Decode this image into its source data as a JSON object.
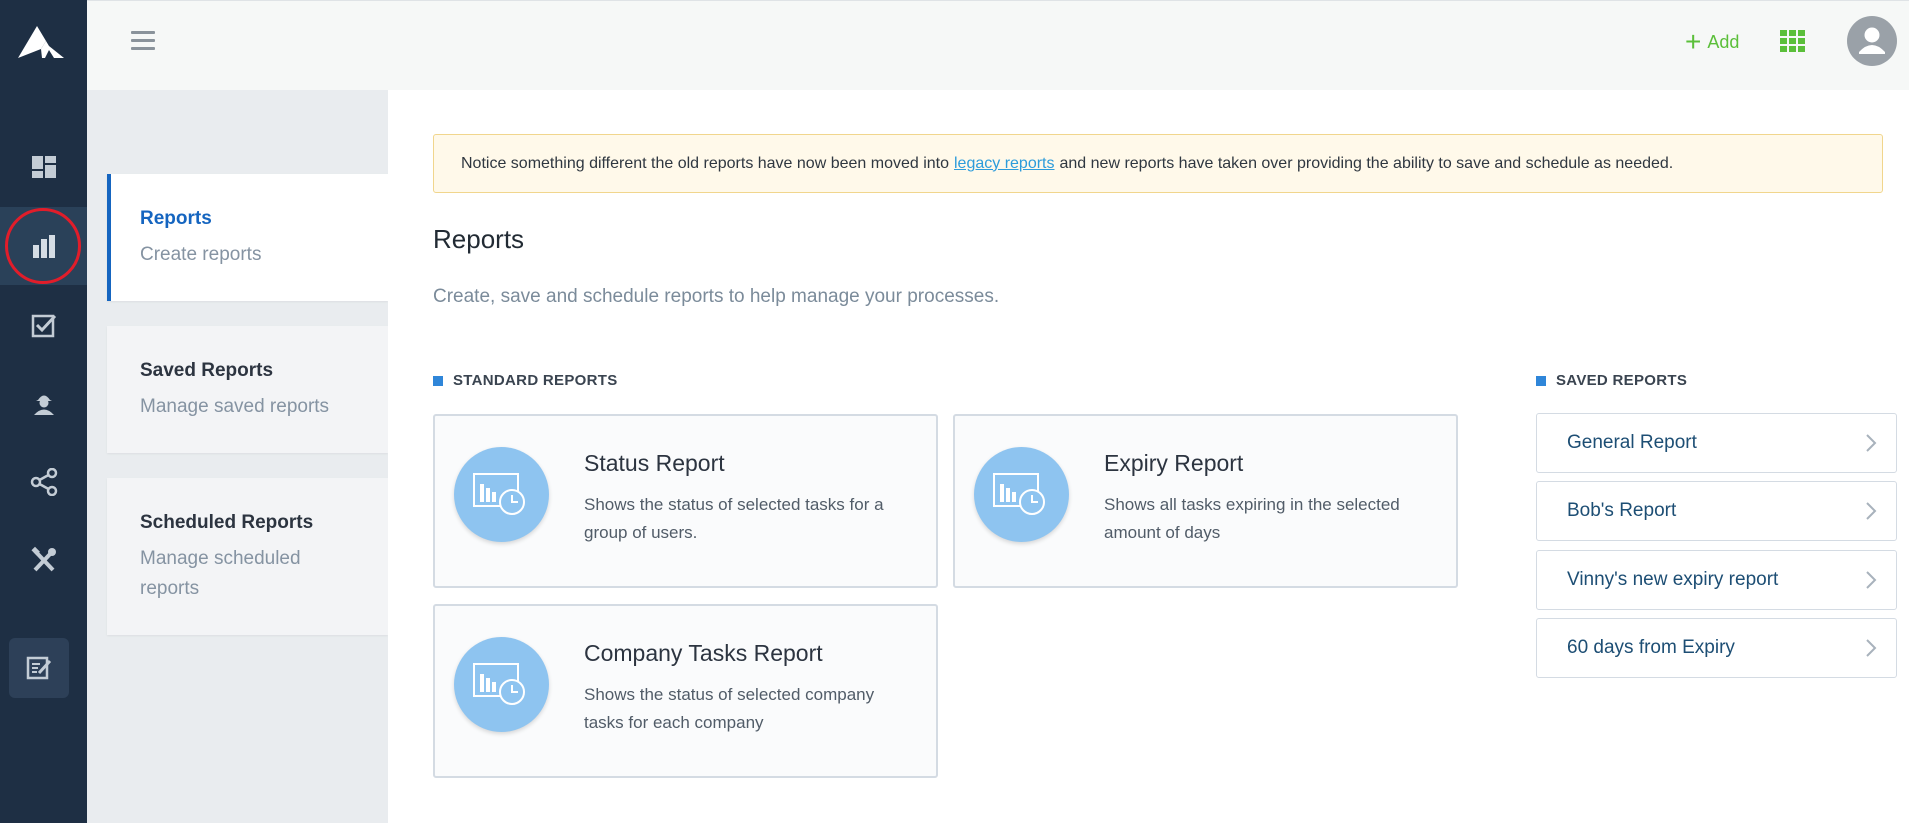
{
  "topbar": {
    "add_label": "Add"
  },
  "left_panel": {
    "items": [
      {
        "title": "Reports",
        "subtitle": "Create reports"
      },
      {
        "title": "Saved Reports",
        "subtitle": "Manage saved reports"
      },
      {
        "title": "Scheduled Reports",
        "subtitle": "Manage scheduled reports"
      }
    ]
  },
  "notice": {
    "before": "Notice something different the old reports have now been moved into",
    "link": "legacy reports",
    "after": "and new reports have taken over providing the ability to save and schedule as needed."
  },
  "main": {
    "title": "Reports",
    "subtitle": "Create, save and schedule reports to help manage your processes."
  },
  "standard_reports": {
    "heading": "STANDARD REPORTS",
    "items": [
      {
        "title": "Status Report",
        "description": "Shows the status of selected tasks for a group of users."
      },
      {
        "title": "Expiry Report",
        "description": "Shows all tasks expiring in the selected amount of days"
      },
      {
        "title": "Company Tasks Report",
        "description": "Shows the status of selected company tasks for each company"
      }
    ]
  },
  "saved_reports": {
    "heading": "SAVED REPORTS",
    "items": [
      {
        "label": "General Report"
      },
      {
        "label": "Bob's Report"
      },
      {
        "label": "Vinny's new expiry report"
      },
      {
        "label": "60 days from Expiry"
      }
    ]
  },
  "colors": {
    "rail": "#1e2f44",
    "accent_green": "#5bbf3a",
    "active_blue": "#1565c0",
    "highlight_circle": "#e11d2a"
  }
}
